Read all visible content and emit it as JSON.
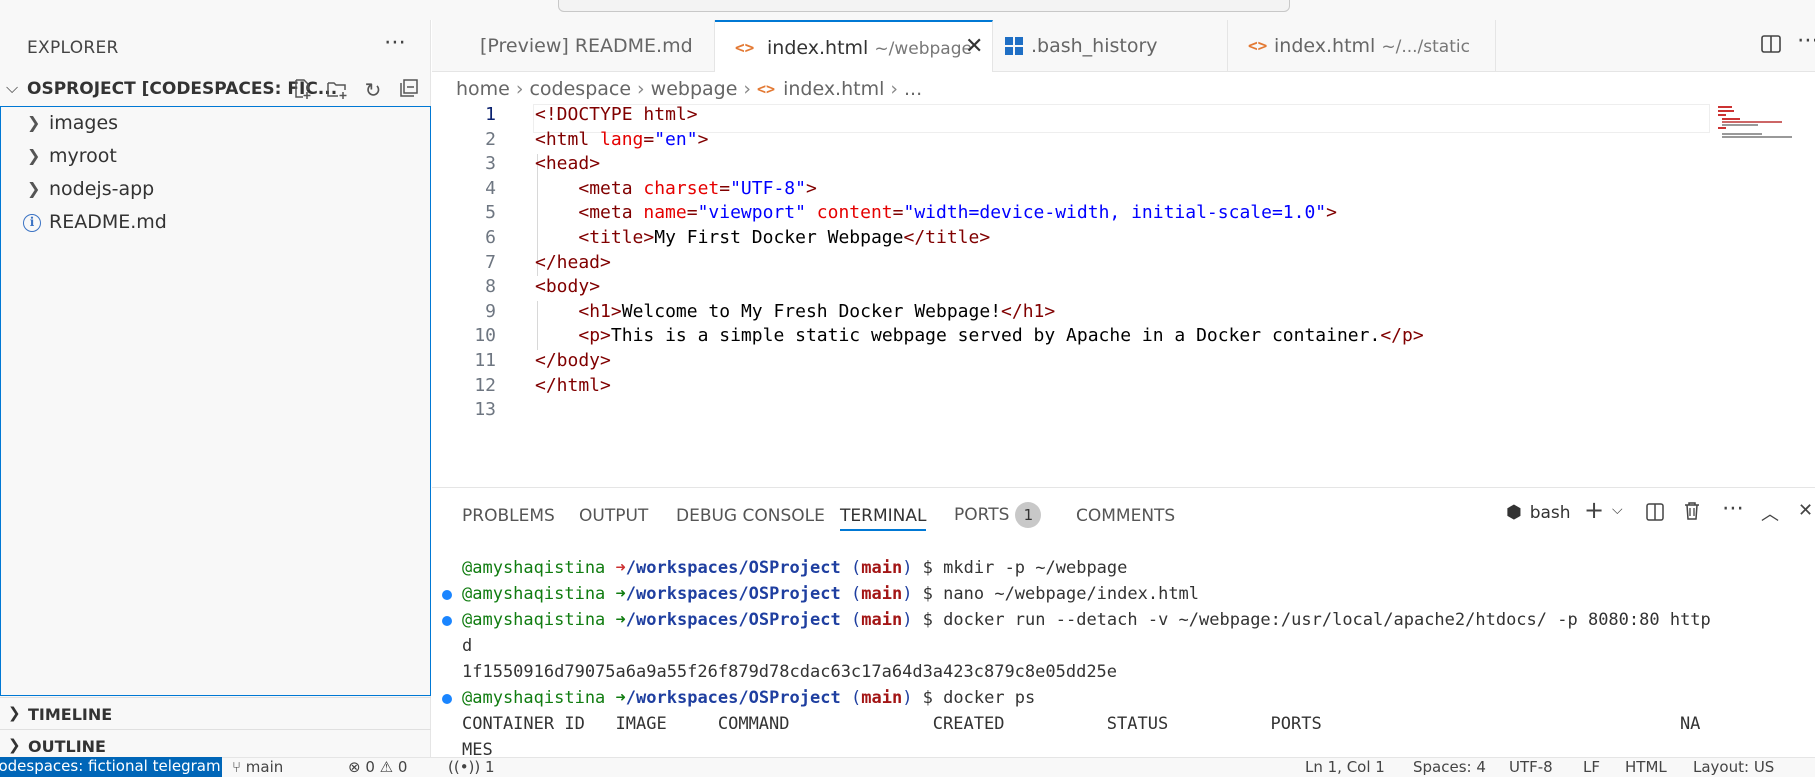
{
  "sidebar": {
    "title": "EXPLORER",
    "project": "OSPROJECT [CODESPACES: FIC...",
    "tree": [
      {
        "label": "images",
        "type": "folder"
      },
      {
        "label": "myroot",
        "type": "folder"
      },
      {
        "label": "nodejs-app",
        "type": "folder"
      },
      {
        "label": "README.md",
        "type": "file"
      }
    ],
    "timeline": "TIMELINE",
    "outline": "OUTLINE"
  },
  "tabs": [
    {
      "label": "[Preview] README.md",
      "desc": ""
    },
    {
      "label": "index.html",
      "desc": "~/webpage"
    },
    {
      "label": ".bash_history",
      "desc": ""
    },
    {
      "label": "index.html",
      "desc": "~/.../static"
    }
  ],
  "breadcrumb": [
    "home",
    "codespace",
    "webpage",
    "index.html",
    "..."
  ],
  "editor": {
    "line_numbers": [
      "1",
      "2",
      "3",
      "4",
      "5",
      "6",
      "7",
      "8",
      "9",
      "10",
      "11",
      "12",
      "13"
    ],
    "lines": [
      "<!DOCTYPE html>",
      "<html lang=\"en\">",
      "<head>",
      "    <meta charset=\"UTF-8\">",
      "    <meta name=\"viewport\" content=\"width=device-width, initial-scale=1.0\">",
      "    <title>My First Docker Webpage</title>",
      "</head>",
      "<body>",
      "    <h1>Welcome to My Fresh Docker Webpage!</h1>",
      "    <p>This is a simple static webpage served by Apache in a Docker container.</p>",
      "</body>",
      "</html>",
      ""
    ]
  },
  "panel": {
    "tabs": [
      "PROBLEMS",
      "OUTPUT",
      "DEBUG CONSOLE",
      "TERMINAL",
      "PORTS",
      "COMMENTS"
    ],
    "ports_count": "1",
    "shell": "bash"
  },
  "terminal": {
    "user": "@amyshaqistina",
    "path": "/workspaces/OSProject",
    "branch": "main",
    "commands": [
      "mkdir -p ~/webpage",
      "nano ~/webpage/index.html",
      "docker run --detach -v ~/webpage:/usr/local/apache2/htdocs/ -p 8080:80 http",
      "docker ps"
    ],
    "wrap": "d",
    "container_hash": "1f1550916d79075a6a9a55f26f879d78cdac63c17a64d3a423c879c8e05dd25e",
    "table_header": "CONTAINER ID   IMAGE     COMMAND              CREATED          STATUS          PORTS                                   NA",
    "table_wrap": "MES"
  },
  "statusbar": {
    "remote": "Codespaces: fictional telegram",
    "branch": "main",
    "problems": "0",
    "warnings": "0",
    "ports": "1",
    "position": "Ln 1, Col 1",
    "spaces": "Spaces: 4",
    "encoding": "UTF-8",
    "eol": "LF",
    "language": "HTML",
    "layout": "Layout: US"
  }
}
